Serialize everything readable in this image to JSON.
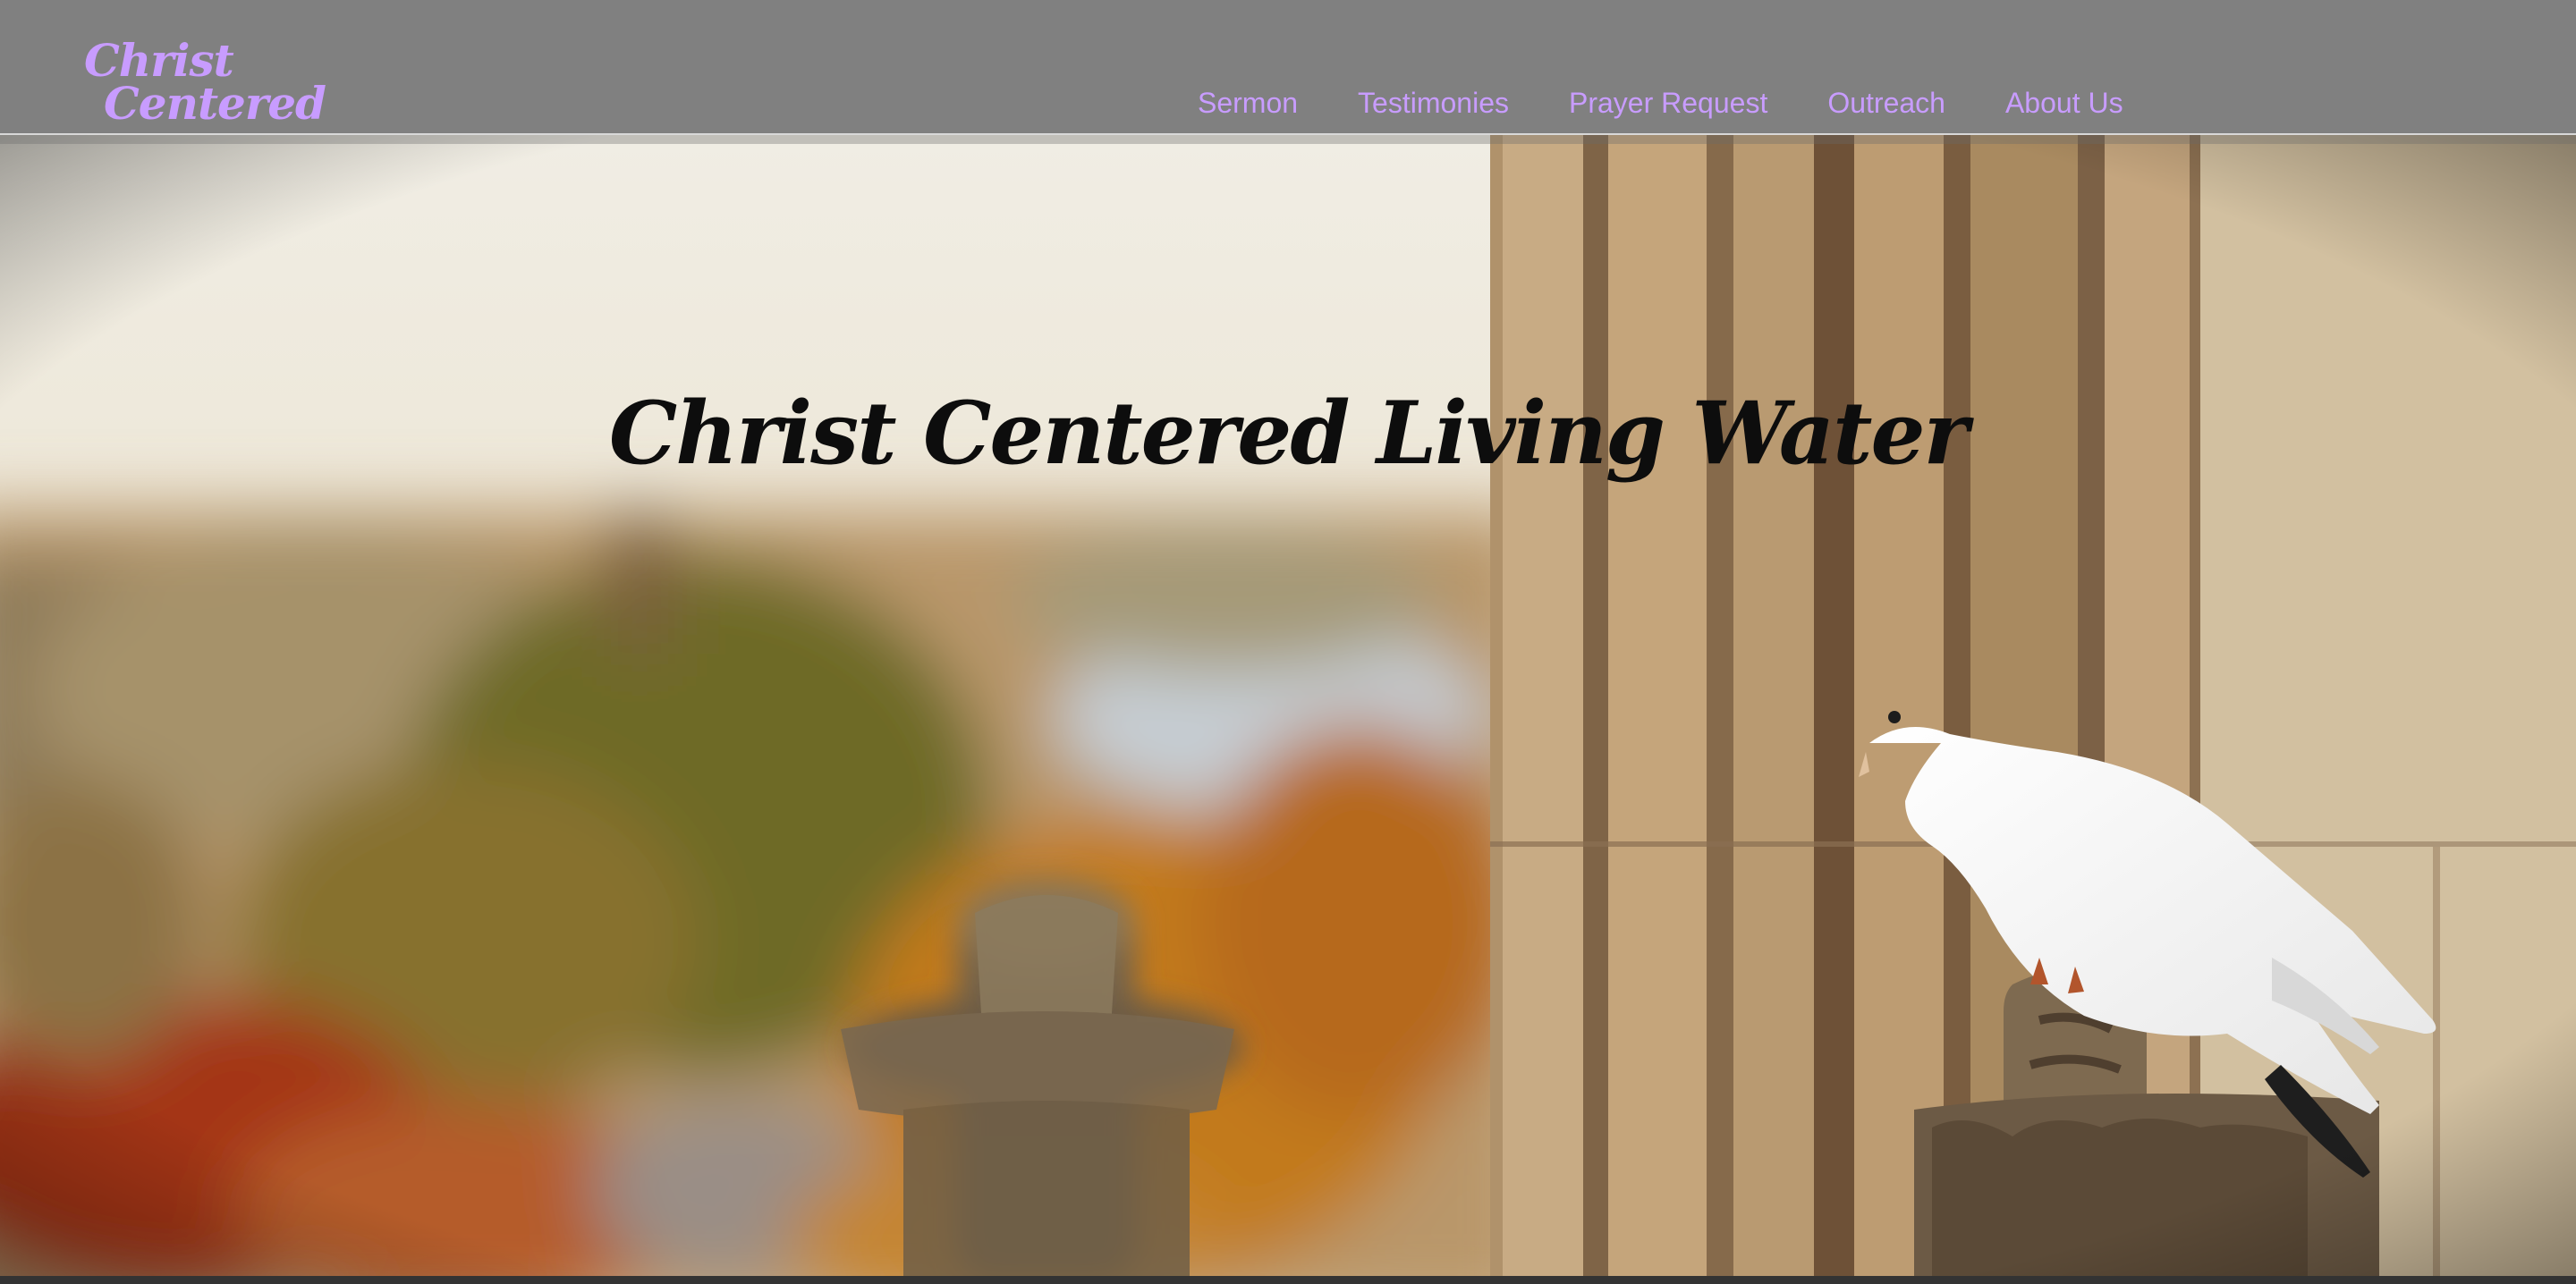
{
  "header": {
    "logo_line1": "Christ",
    "logo_line2": "Centered",
    "accent_color": "#c89cff",
    "background_color": "#808080"
  },
  "nav": {
    "items": [
      {
        "label": "Sermon"
      },
      {
        "label": "Testimonies"
      },
      {
        "label": "Prayer Request"
      },
      {
        "label": "Outreach"
      },
      {
        "label": "About Us"
      }
    ]
  },
  "hero": {
    "title": "Christ Centered Living Water",
    "image": "dove-on-stone-column-photo"
  }
}
